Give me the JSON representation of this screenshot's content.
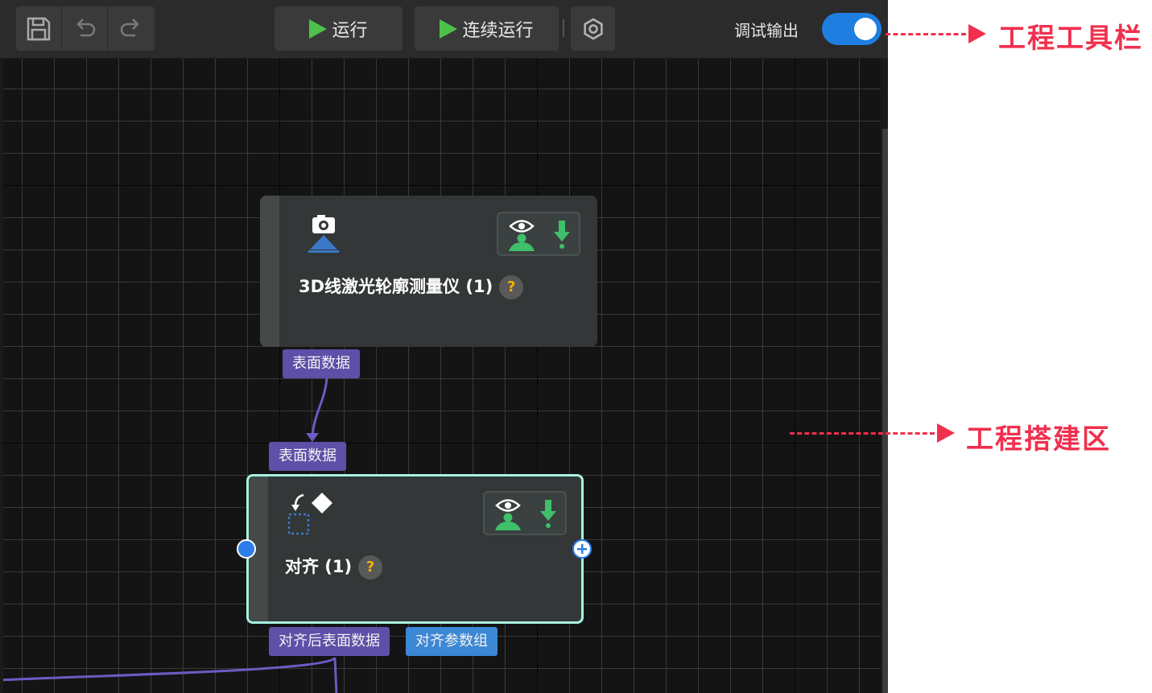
{
  "toolbar": {
    "save_icon": "save-icon",
    "undo_icon": "undo-icon",
    "redo_icon": "redo-icon",
    "run_label": "运行",
    "continuous_run_label": "连续运行",
    "settings_icon": "gear-icon",
    "debug_output_label": "调试输出",
    "debug_output_enabled": true
  },
  "nodes": [
    {
      "title": "3D线激光轮廓测量仪 (1)",
      "icon": "camera-sensor-icon",
      "help": "?",
      "output_port": "表面数据"
    },
    {
      "title": "对齐 (1)",
      "icon": "align-icon",
      "help": "?",
      "input_port": "表面数据",
      "output_ports": [
        "对齐后表面数据",
        "对齐参数组"
      ]
    }
  ],
  "annotations": {
    "toolbar_label": "工程工具栏",
    "workspace_label": "工程搭建区"
  },
  "colors": {
    "accent_blue": "#1e7fe0",
    "play_green": "#4cc24a",
    "port_purple": "#5e4fa8",
    "port_blue": "#3c87d6",
    "annotation_red": "#f0304e",
    "selected_border": "#a8f0e0"
  }
}
